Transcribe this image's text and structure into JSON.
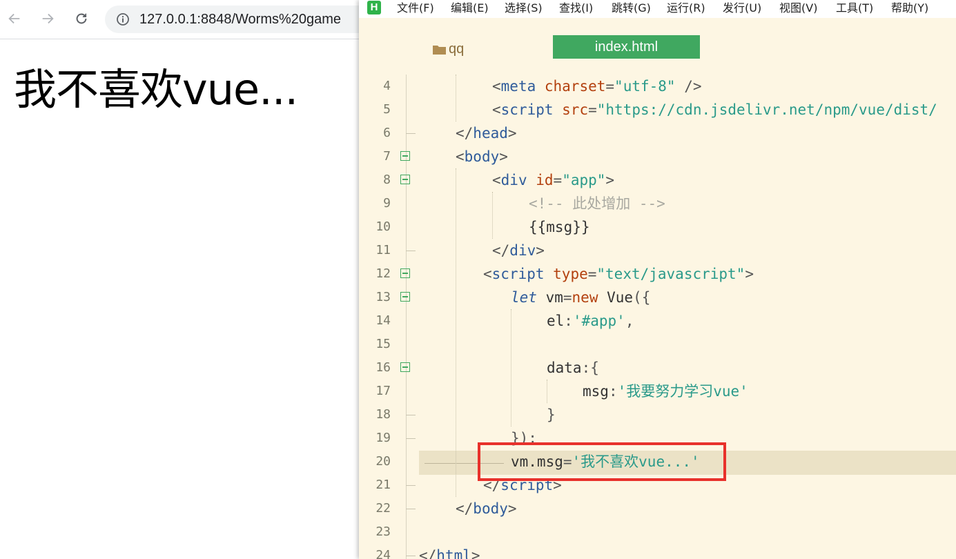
{
  "browser": {
    "url": "127.0.0.1:8848/Worms%20game",
    "page_text": "我不喜欢vue..."
  },
  "ide": {
    "logo": "H",
    "menu": [
      "文件(F)",
      "编辑(E)",
      "选择(S)",
      "查找(I)",
      "跳转(G)",
      "运行(R)",
      "发行(U)",
      "视图(V)",
      "工具(T)",
      "帮助(Y)"
    ],
    "project_tab": "qq",
    "file_tab": "index.html",
    "line_numbers": [
      "4",
      "5",
      "6",
      "7",
      "8",
      "9",
      "10",
      "11",
      "12",
      "13",
      "14",
      "15",
      "16",
      "17",
      "18",
      "19",
      "20",
      "21",
      "22",
      "23",
      "24"
    ],
    "code": {
      "l4": {
        "open": "<",
        "tag": "meta",
        "attr": " charset",
        "eq": "=",
        "val": "\"utf-8\"",
        "close": " />"
      },
      "l5": {
        "open": "<",
        "tag": "script",
        "attr": " src",
        "eq": "=",
        "val": "\"https://cdn.jsdelivr.net/npm/vue/dist/"
      },
      "l6": {
        "open": "</",
        "tag": "head",
        "close": ">"
      },
      "l7": {
        "open": "<",
        "tag": "body",
        "close": ">"
      },
      "l8": {
        "open": "<",
        "tag": "div",
        "attr": " id",
        "eq": "=",
        "val": "\"app\"",
        "close": ">"
      },
      "l9": {
        "comment": "<!-- 此处增加 -->"
      },
      "l10": {
        "text": "{{msg}}"
      },
      "l11": {
        "open": "</",
        "tag": "div",
        "close": ">"
      },
      "l12": {
        "open": "<",
        "tag": "script",
        "attr": " type",
        "eq": "=",
        "val": "\"text/javascript\"",
        "close": ">"
      },
      "l13": {
        "kw": "let",
        "a": " vm",
        "eq": "=",
        "kw2": "new",
        "b": " Vue",
        "c": "({"
      },
      "l14": {
        "a": "el",
        "b": ":",
        "val": "'#app'",
        "c": ","
      },
      "l16": {
        "a": "data",
        "b": ":{"
      },
      "l17": {
        "a": "msg",
        "b": ":",
        "val": "'我要努力学习vue'"
      },
      "l18": {
        "a": "}"
      },
      "l19": {
        "a": "});"
      },
      "l20": {
        "a": "vm.msg",
        "eq": "=",
        "val": "'我不喜欢vue...'"
      },
      "l21": {
        "open": "</",
        "tag": "script",
        "close": ">"
      },
      "l22": {
        "open": "</",
        "tag": "body",
        "close": ">"
      },
      "l24": {
        "open": "</",
        "tag": "html",
        "close": ">"
      }
    }
  },
  "colors": {
    "ide_background": "#fdf6e3",
    "tab_active": "#40a860",
    "highlight_box": "#e8312b"
  }
}
